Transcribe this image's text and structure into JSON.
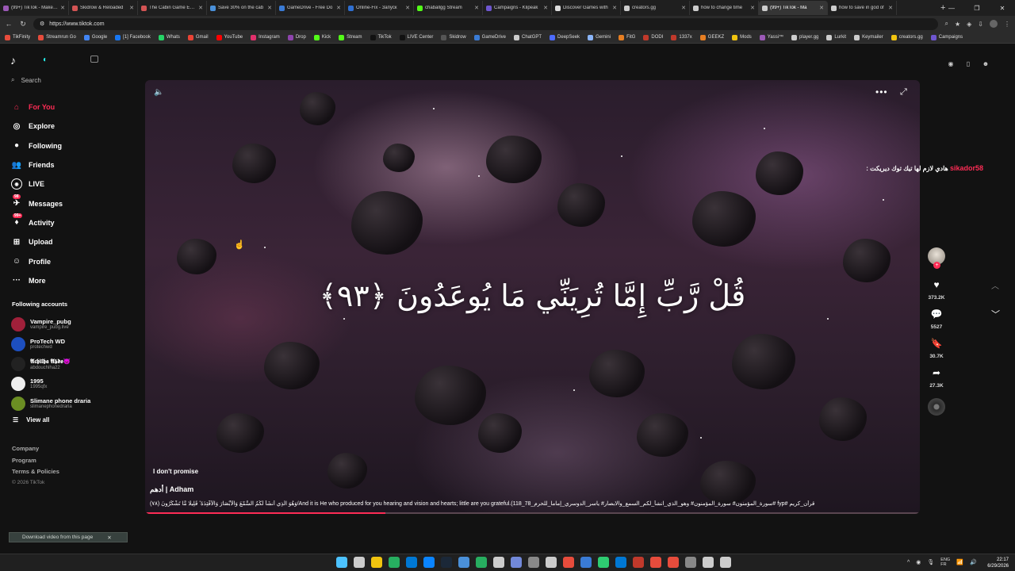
{
  "browser": {
    "tabs": [
      {
        "label": "(99+) TikTok - Make Yo",
        "color": "#9b59b6"
      },
      {
        "label": "Skidrow & Reloaded",
        "color": "#d35454"
      },
      {
        "label": "The Cabin Game Early",
        "color": "#d35454"
      },
      {
        "label": "Save 30% on the cab",
        "color": "#4a90d9"
      },
      {
        "label": "GameDrive - Free Do",
        "color": "#3a7bd5"
      },
      {
        "label": "Online-Fix - Запуск",
        "color": "#2f6fd1"
      },
      {
        "label": "chaballgg Stream",
        "color": "#53fc18"
      },
      {
        "label": "Campaigns - Klipeak",
        "color": "#6e56cf"
      },
      {
        "label": "Discover Games with",
        "color": "#dddddd"
      },
      {
        "label": "creators.gg",
        "color": "#cccccc"
      },
      {
        "label": "how to change time",
        "color": "#cccccc"
      },
      {
        "label": "(99+) TikTok - Ma",
        "color": "#cccccc",
        "active": true
      },
      {
        "label": "how to save in god of",
        "color": "#cccccc"
      }
    ],
    "new_tab": "+",
    "url": "https://www.tiktok.com",
    "bookmarks": [
      {
        "label": "TikFinity",
        "color": "#e74c3c"
      },
      {
        "label": "Streamrun Go",
        "color": "#e74c3c"
      },
      {
        "label": "Google",
        "color": "#4285f4"
      },
      {
        "label": "[1] Facebook",
        "color": "#1877f2"
      },
      {
        "label": "Whats",
        "color": "#25d366"
      },
      {
        "label": "Gmail",
        "color": "#ea4335"
      },
      {
        "label": "YouTube",
        "color": "#ff0000"
      },
      {
        "label": "Instagram",
        "color": "#e1306c"
      },
      {
        "label": "Drop",
        "color": "#8e44ad"
      },
      {
        "label": "Kick",
        "color": "#53fc18"
      },
      {
        "label": "Stream",
        "color": "#53fc18"
      },
      {
        "label": "TikTok",
        "color": "#111111"
      },
      {
        "label": "LIVE Center",
        "color": "#111111"
      },
      {
        "label": "Skidrow",
        "color": "#555555"
      },
      {
        "label": "GameDrive",
        "color": "#3a7bd5"
      },
      {
        "label": "ChatGPT",
        "color": "#cccccc"
      },
      {
        "label": "DeepSeek",
        "color": "#4d6bfe"
      },
      {
        "label": "Gemini",
        "color": "#8ab4f8"
      },
      {
        "label": "FitG",
        "color": "#e67e22"
      },
      {
        "label": "DODI",
        "color": "#c0392b"
      },
      {
        "label": "1337x",
        "color": "#c0392b"
      },
      {
        "label": "GEEKZ",
        "color": "#e67e22"
      },
      {
        "label": "Mods",
        "color": "#f1c40f"
      },
      {
        "label": "Yassi™",
        "color": "#9b59b6"
      },
      {
        "label": "player.gg",
        "color": "#cccccc"
      },
      {
        "label": "Lurkit",
        "color": "#cccccc"
      },
      {
        "label": "Keymailer",
        "color": "#cccccc"
      },
      {
        "label": "creators.gg",
        "color": "#f1c40f"
      },
      {
        "label": "Campaigns",
        "color": "#6e56cf"
      }
    ]
  },
  "sidebar": {
    "search_placeholder": "Search",
    "nav": [
      {
        "label": "For You",
        "icon": "⌂",
        "active": true
      },
      {
        "label": "Explore",
        "icon": "◎"
      },
      {
        "label": "Following",
        "icon": "●"
      },
      {
        "label": "Friends",
        "icon": "👥"
      },
      {
        "label": "LIVE",
        "icon": "LIVE"
      },
      {
        "label": "Messages",
        "icon": "✈",
        "badge": "98"
      },
      {
        "label": "Activity",
        "icon": "♦",
        "badge": "99+"
      },
      {
        "label": "Upload",
        "icon": "⊞"
      },
      {
        "label": "Profile",
        "icon": "☺"
      },
      {
        "label": "More",
        "icon": "···"
      }
    ],
    "following_header": "Following accounts",
    "following": [
      {
        "name": "Vampire_pubg",
        "user": "vampire_pubg.live",
        "color": "#a0203a"
      },
      {
        "name": "ProTech WD",
        "user": "protechwd",
        "color": "#1d4fbf"
      },
      {
        "name": "𝕬𝖈𝖍𝖎𝖑𝖍𝖆 𝕬𝖇𝖉𝖔😈",
        "user": "abdouchiha22",
        "color": "#222222"
      },
      {
        "name": "1995",
        "user": "1995qfx",
        "color": "#eeeeee"
      },
      {
        "name": "Slimane phone draria",
        "user": "slimanephonedraria",
        "color": "#6b8e23"
      }
    ],
    "view_all": "View all",
    "footer": [
      "Company",
      "Program",
      "Terms & Policies"
    ],
    "copyright": "© 2026 TikTok",
    "download_label": "Download video from this page"
  },
  "video": {
    "verse": "قُلْ رَّبِّ إِمَّا تُرِيَنِّي مَا يُوعَدُونَ ﴿٩٣﴾",
    "caption": "I don't promise",
    "author": "أدهم | Adham",
    "description": "(وَهُوَ الَّذِي أَنشَأَ لَكُمُ السَّمْعَ وَالْأَبْصَارَ وَالْأَفْئِدَةَ ۚ قَلِيلًا مَّا تَشْكُرُونَ (٧٨/And it is He who produced for you hearing and vision and hearts; little are you grateful.(118_78_سورة_المؤمنون# سورة_المؤمنون# وهو_الذي_انشأ_لكم_السمع_والابصار# ياسر_الدوسري_إماما_للحرم# fyp# قرآن_كريم",
    "progress_fraction": 0.31,
    "comment_user": "sikador58",
    "comment_text": ": هادي لازم لها تيك توك ديريكت",
    "likes": "373.2K",
    "comments": "5527",
    "saves": "30.7K",
    "shares": "27.3K"
  },
  "taskbar": {
    "icons": [
      "#4cc2ff",
      "#cccccc",
      "#f1c40f",
      "#27ae60",
      "#0078d4",
      "#0a84ff",
      "#1b2838",
      "#4a90d9",
      "#27ae60",
      "#cccccc",
      "#7289da",
      "#888888",
      "#cccccc",
      "#e74c3c",
      "#3a7bd5",
      "#2ecc71",
      "#0078d4",
      "#c0392b",
      "#e74c3c",
      "#e74c3c",
      "#888888",
      "#cccccc",
      "#cccccc"
    ],
    "lang": "ENG",
    "lang_sub": "FR",
    "time": "22:17",
    "date": "6/29/2026"
  }
}
